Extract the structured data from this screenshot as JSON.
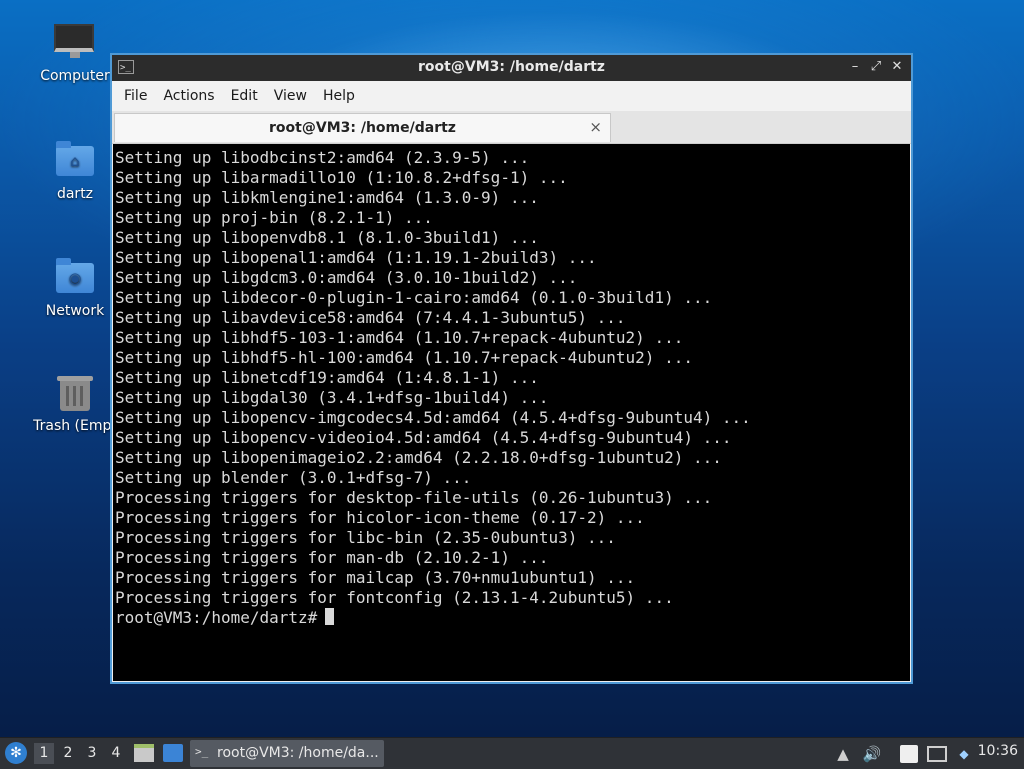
{
  "desktop": {
    "icons": [
      {
        "label": "Computer",
        "icon": "computer-icon"
      },
      {
        "label": "dartz",
        "icon": "home-folder-icon"
      },
      {
        "label": "Network",
        "icon": "network-folder-icon"
      },
      {
        "label": "Trash (Empt",
        "icon": "trash-icon"
      }
    ]
  },
  "window": {
    "title": "root@VM3: /home/dartz",
    "menu": [
      "File",
      "Actions",
      "Edit",
      "View",
      "Help"
    ],
    "tab": {
      "title": "root@VM3: /home/dartz",
      "close": "×"
    },
    "terminal": {
      "lines": [
        "Setting up libodbcinst2:amd64 (2.3.9-5) ...",
        "Setting up libarmadillo10 (1:10.8.2+dfsg-1) ...",
        "Setting up libkmlengine1:amd64 (1.3.0-9) ...",
        "Setting up proj-bin (8.2.1-1) ...",
        "Setting up libopenvdb8.1 (8.1.0-3build1) ...",
        "Setting up libopenal1:amd64 (1:1.19.1-2build3) ...",
        "Setting up libgdcm3.0:amd64 (3.0.10-1build2) ...",
        "Setting up libdecor-0-plugin-1-cairo:amd64 (0.1.0-3build1) ...",
        "Setting up libavdevice58:amd64 (7:4.4.1-3ubuntu5) ...",
        "Setting up libhdf5-103-1:amd64 (1.10.7+repack-4ubuntu2) ...",
        "Setting up libhdf5-hl-100:amd64 (1.10.7+repack-4ubuntu2) ...",
        "Setting up libnetcdf19:amd64 (1:4.8.1-1) ...",
        "Setting up libgdal30 (3.4.1+dfsg-1build4) ...",
        "Setting up libopencv-imgcodecs4.5d:amd64 (4.5.4+dfsg-9ubuntu4) ...",
        "Setting up libopencv-videoio4.5d:amd64 (4.5.4+dfsg-9ubuntu4) ...",
        "Setting up libopenimageio2.2:amd64 (2.2.18.0+dfsg-1ubuntu2) ...",
        "Setting up blender (3.0.1+dfsg-7) ...",
        "Processing triggers for desktop-file-utils (0.26-1ubuntu3) ...",
        "Processing triggers for hicolor-icon-theme (0.17-2) ...",
        "Processing triggers for libc-bin (2.35-0ubuntu3) ...",
        "Processing triggers for man-db (2.10.2-1) ...",
        "Processing triggers for mailcap (3.70+nmu1ubuntu1) ...",
        "Processing triggers for fontconfig (2.13.1-4.2ubuntu5) ..."
      ],
      "prompt": "root@VM3:/home/dartz#"
    }
  },
  "taskbar": {
    "workspaces": [
      "1",
      "2",
      "3",
      "4"
    ],
    "active_workspace": "1",
    "task_label": "root@VM3: /home/da...",
    "clock": "10:36"
  },
  "colors": {
    "window_border": "#4f9ad6",
    "titlebar": "#2c2c2c",
    "terminal_bg": "#000000",
    "terminal_fg": "#d9d9d9",
    "taskbar": "#2f3237"
  }
}
